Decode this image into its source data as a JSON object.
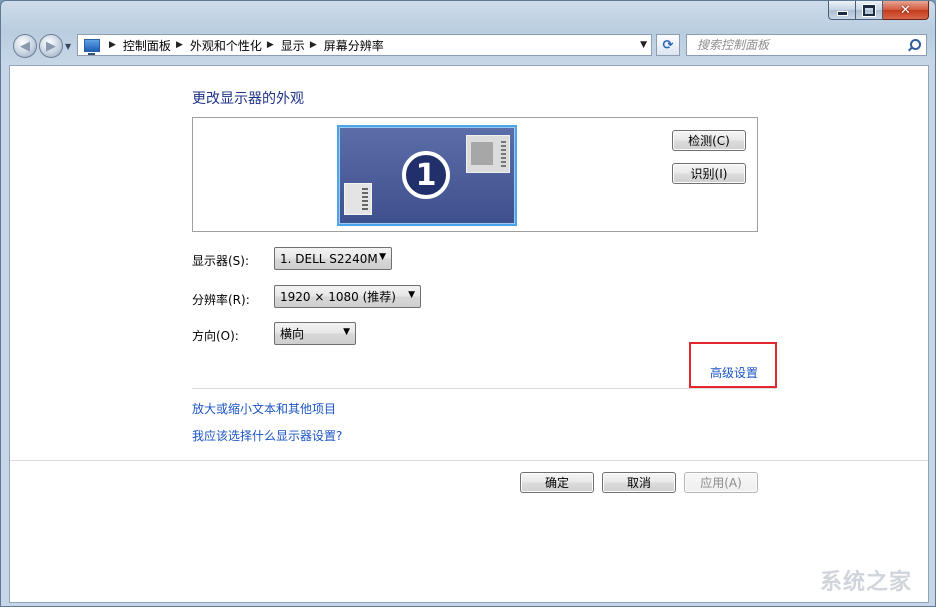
{
  "window": {
    "caption_buttons": {
      "close_glyph": "✕"
    }
  },
  "address_bar": {
    "breadcrumbs": [
      "控制面板",
      "外观和个性化",
      "显示",
      "屏幕分辨率"
    ],
    "refresh_glyph": "⟳"
  },
  "search": {
    "placeholder": "搜索控制面板"
  },
  "page": {
    "title": "更改显示器的外观",
    "monitor_number": "1",
    "detect_button": "检测(C)",
    "identify_button": "识别(I)",
    "display_label": "显示器(S):",
    "display_value": "1. DELL S2240M",
    "resolution_label": "分辨率(R):",
    "resolution_value": "1920 × 1080 (推荐)",
    "orientation_label": "方向(O):",
    "orientation_value": "横向",
    "advanced_link": "高级设置",
    "link_text_size": "放大或缩小文本和其他项目",
    "link_help": "我应该选择什么显示器设置?",
    "ok_button": "确定",
    "cancel_button": "取消",
    "apply_button": "应用(A)"
  },
  "watermark": "系统之家",
  "colors": {
    "title": "#1e3287",
    "link": "#1b55c4",
    "highlight": "#e3272c",
    "monitor_border": "#4ea4e8"
  }
}
